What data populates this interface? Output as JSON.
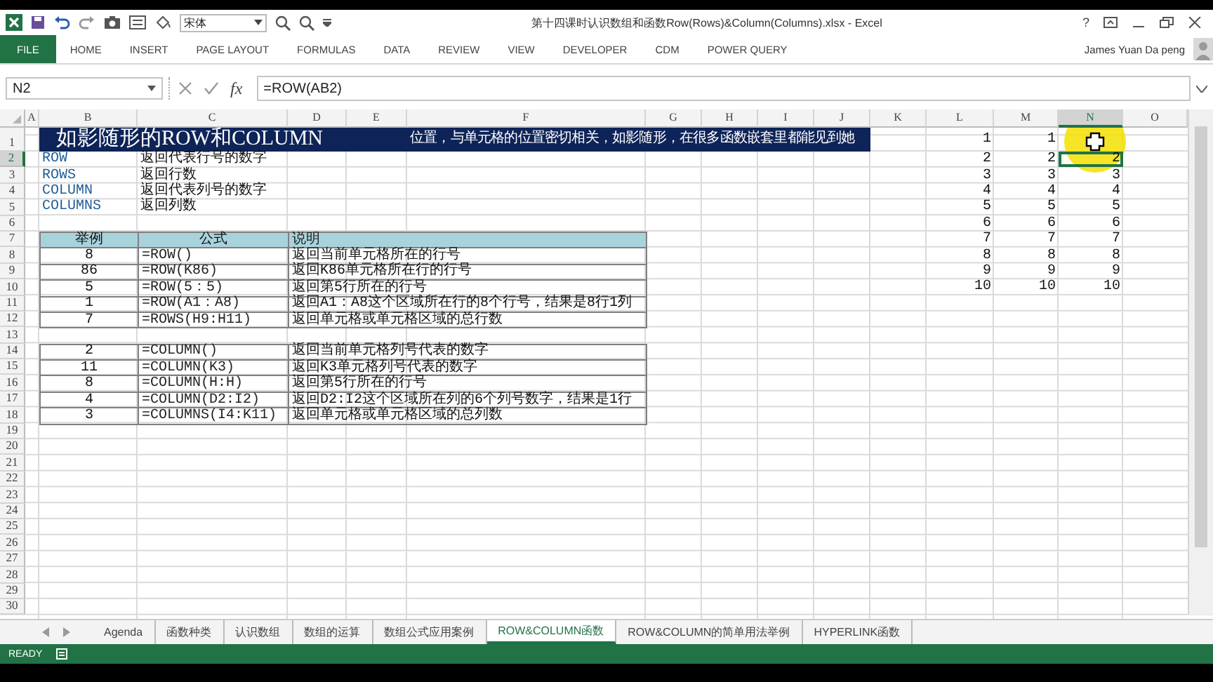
{
  "title_bar": {
    "font_name": "宋体",
    "title": "第十四课时认识数组和函数Row(Rows)&Column(Columns).xlsx - Excel",
    "help": "?"
  },
  "ribbon_tabs": [
    {
      "label": "FILE",
      "kind": "file",
      "selected": false
    },
    {
      "label": "HOME",
      "kind": "tab",
      "selected": false
    },
    {
      "label": "INSERT",
      "kind": "tab",
      "selected": false
    },
    {
      "label": "PAGE LAYOUT",
      "kind": "tab",
      "selected": false
    },
    {
      "label": "FORMULAS",
      "kind": "tab",
      "selected": false
    },
    {
      "label": "DATA",
      "kind": "tab",
      "selected": false
    },
    {
      "label": "REVIEW",
      "kind": "tab",
      "selected": false
    },
    {
      "label": "VIEW",
      "kind": "tab",
      "selected": false
    },
    {
      "label": "DEVELOPER",
      "kind": "tab",
      "selected": false
    },
    {
      "label": "CDM",
      "kind": "tab",
      "selected": false
    },
    {
      "label": "POWER QUERY",
      "kind": "tab",
      "selected": false
    }
  ],
  "user": "James Yuan Da peng",
  "formula_bar": {
    "name_box": "N2",
    "insert_function": "fx",
    "formula": "=ROW(AB2)"
  },
  "columns": [
    {
      "label": "A",
      "selected": false
    },
    {
      "label": "B",
      "selected": false
    },
    {
      "label": "C",
      "selected": false
    },
    {
      "label": "D",
      "selected": false
    },
    {
      "label": "E",
      "selected": false
    },
    {
      "label": "F",
      "selected": false
    },
    {
      "label": "G",
      "selected": false
    },
    {
      "label": "H",
      "selected": false
    },
    {
      "label": "I",
      "selected": false
    },
    {
      "label": "J",
      "selected": false
    },
    {
      "label": "K",
      "selected": false
    },
    {
      "label": "L",
      "selected": false
    },
    {
      "label": "M",
      "selected": false
    },
    {
      "label": "N",
      "selected": true
    },
    {
      "label": "O",
      "selected": false
    }
  ],
  "rows": [
    {
      "number": "1",
      "kind": "title",
      "selected": false,
      "cells": {
        "B": {
          "text": "如影随形的ROW和COLUMN",
          "kind": "heading",
          "selected": false
        },
        "F": {
          "text": "位置，与单元格的位置密切相关，如影随形，在很多函数嵌套里都能见到她",
          "kind": "note",
          "selected": false
        },
        "L": {
          "text": "1",
          "kind": "number",
          "selected": false
        },
        "M": {
          "text": "1",
          "kind": "number",
          "selected": false
        }
      }
    },
    {
      "number": "2",
      "kind": "plain",
      "selected": true,
      "cells": {
        "B": {
          "text": "ROW",
          "kind": "function",
          "selected": false
        },
        "C": {
          "text": "返回代表行号的数字",
          "kind": "text",
          "selected": false
        },
        "L": {
          "text": "2",
          "kind": "number",
          "selected": false
        },
        "M": {
          "text": "2",
          "kind": "number",
          "selected": false
        },
        "N": {
          "text": "2",
          "kind": "number",
          "selected": true
        }
      }
    },
    {
      "number": "3",
      "kind": "plain",
      "selected": false,
      "cells": {
        "B": {
          "text": "ROWS",
          "kind": "function",
          "selected": false
        },
        "C": {
          "text": "返回行数",
          "kind": "text",
          "selected": false
        },
        "L": {
          "text": "3",
          "kind": "number",
          "selected": false
        },
        "M": {
          "text": "3",
          "kind": "number",
          "selected": false
        },
        "N": {
          "text": "3",
          "kind": "number",
          "selected": false
        }
      }
    },
    {
      "number": "4",
      "kind": "plain",
      "selected": false,
      "cells": {
        "B": {
          "text": "COLUMN",
          "kind": "function",
          "selected": false
        },
        "C": {
          "text": "返回代表列号的数字",
          "kind": "text",
          "selected": false
        },
        "L": {
          "text": "4",
          "kind": "number",
          "selected": false
        },
        "M": {
          "text": "4",
          "kind": "number",
          "selected": false
        },
        "N": {
          "text": "4",
          "kind": "number",
          "selected": false
        }
      }
    },
    {
      "number": "5",
      "kind": "plain",
      "selected": false,
      "cells": {
        "B": {
          "text": "COLUMNS",
          "kind": "function",
          "selected": false
        },
        "C": {
          "text": "返回列数",
          "kind": "text",
          "selected": false
        },
        "L": {
          "text": "5",
          "kind": "number",
          "selected": false
        },
        "M": {
          "text": "5",
          "kind": "number",
          "selected": false
        },
        "N": {
          "text": "5",
          "kind": "number",
          "selected": false
        }
      }
    },
    {
      "number": "6",
      "kind": "plain",
      "selected": false,
      "cells": {
        "L": {
          "text": "6",
          "kind": "number",
          "selected": false
        },
        "M": {
          "text": "6",
          "kind": "number",
          "selected": false
        },
        "N": {
          "text": "6",
          "kind": "number",
          "selected": false
        }
      }
    },
    {
      "number": "7",
      "kind": "table-head",
      "selected": false,
      "cells": {
        "B": {
          "text": "举例",
          "kind": "header",
          "selected": false
        },
        "C": {
          "text": "公式",
          "kind": "header",
          "selected": false
        },
        "D": {
          "text": "说明",
          "kind": "header-left",
          "selected": false
        },
        "L": {
          "text": "7",
          "kind": "number",
          "selected": false
        },
        "M": {
          "text": "7",
          "kind": "number",
          "selected": false
        },
        "N": {
          "text": "7",
          "kind": "number",
          "selected": false
        }
      }
    },
    {
      "number": "8",
      "kind": "table-body",
      "selected": false,
      "cells": {
        "B": {
          "text": "8",
          "kind": "example",
          "selected": false
        },
        "C": {
          "text": "=ROW()",
          "kind": "formula",
          "selected": false
        },
        "D": {
          "text": "返回当前单元格所在的行号",
          "kind": "text",
          "selected": false
        },
        "L": {
          "text": "8",
          "kind": "number",
          "selected": false
        },
        "M": {
          "text": "8",
          "kind": "number",
          "selected": false
        },
        "N": {
          "text": "8",
          "kind": "number",
          "selected": false
        }
      }
    },
    {
      "number": "9",
      "kind": "table-body",
      "selected": false,
      "cells": {
        "B": {
          "text": "86",
          "kind": "example",
          "selected": false
        },
        "C": {
          "text": "=ROW(K86)",
          "kind": "formula",
          "selected": false
        },
        "D": {
          "text": "返回K86单元格所在行的行号",
          "kind": "text",
          "selected": false
        },
        "L": {
          "text": "9",
          "kind": "number",
          "selected": false
        },
        "M": {
          "text": "9",
          "kind": "number",
          "selected": false
        },
        "N": {
          "text": "9",
          "kind": "number",
          "selected": false
        }
      }
    },
    {
      "number": "10",
      "kind": "table-body",
      "selected": false,
      "cells": {
        "B": {
          "text": "5",
          "kind": "example",
          "selected": false
        },
        "C": {
          "text": "=ROW(5：5)",
          "kind": "formula",
          "selected": false
        },
        "D": {
          "text": "返回第5行所在的行号",
          "kind": "text",
          "selected": false
        },
        "L": {
          "text": "10",
          "kind": "number",
          "selected": false
        },
        "M": {
          "text": "10",
          "kind": "number",
          "selected": false
        },
        "N": {
          "text": "10",
          "kind": "number",
          "selected": false
        }
      }
    },
    {
      "number": "11",
      "kind": "table-body",
      "selected": false,
      "cells": {
        "B": {
          "text": "1",
          "kind": "example",
          "selected": false
        },
        "C": {
          "text": "=ROW(A1：A8)",
          "kind": "formula",
          "selected": false
        },
        "D": {
          "text": "返回A1：A8这个区域所在行的8个行号，结果是8行1列",
          "kind": "text",
          "selected": false
        }
      }
    },
    {
      "number": "12",
      "kind": "table-body",
      "selected": false,
      "cells": {
        "B": {
          "text": "7",
          "kind": "example",
          "selected": false
        },
        "C": {
          "text": "=ROWS(H9:H11)",
          "kind": "formula",
          "selected": false
        },
        "D": {
          "text": "返回单元格或单元格区域的总行数",
          "kind": "text",
          "selected": false
        }
      }
    },
    {
      "number": "13",
      "kind": "plain",
      "selected": false
    },
    {
      "number": "14",
      "kind": "table-body",
      "selected": false,
      "cells": {
        "B": {
          "text": "2",
          "kind": "example",
          "selected": false
        },
        "C": {
          "text": "=COLUMN()",
          "kind": "formula",
          "selected": false
        },
        "D": {
          "text": "返回当前单元格列号代表的数字",
          "kind": "text",
          "selected": false
        }
      }
    },
    {
      "number": "15",
      "kind": "table-body",
      "selected": false,
      "cells": {
        "B": {
          "text": "11",
          "kind": "example",
          "selected": false
        },
        "C": {
          "text": "=COLUMN(K3)",
          "kind": "formula",
          "selected": false
        },
        "D": {
          "text": "返回K3单元格列号代表的数字",
          "kind": "text",
          "selected": false
        }
      }
    },
    {
      "number": "16",
      "kind": "table-body",
      "selected": false,
      "cells": {
        "B": {
          "text": "8",
          "kind": "example",
          "selected": false
        },
        "C": {
          "text": "=COLUMN(H:H)",
          "kind": "formula",
          "selected": false
        },
        "D": {
          "text": "返回第5行所在的行号",
          "kind": "text",
          "selected": false
        }
      }
    },
    {
      "number": "17",
      "kind": "table-body",
      "selected": false,
      "cells": {
        "B": {
          "text": "4",
          "kind": "example",
          "selected": false
        },
        "C": {
          "text": "=COLUMN(D2:I2)",
          "kind": "formula",
          "selected": false
        },
        "D": {
          "text": "返回D2:I2这个区域所在列的6个列号数字，结果是1行",
          "kind": "text",
          "selected": false
        }
      }
    },
    {
      "number": "18",
      "kind": "table-body",
      "selected": false,
      "cells": {
        "B": {
          "text": "3",
          "kind": "example",
          "selected": false
        },
        "C": {
          "text": "=COLUMNS(I4:K11)",
          "kind": "formula",
          "selected": false
        },
        "D": {
          "text": "返回单元格或单元格区域的总列数",
          "kind": "text",
          "selected": false
        }
      }
    },
    {
      "number": "19",
      "kind": "plain",
      "selected": false
    },
    {
      "number": "20",
      "kind": "plain",
      "selected": false
    },
    {
      "number": "21",
      "kind": "plain",
      "selected": false
    },
    {
      "number": "22",
      "kind": "plain",
      "selected": false
    },
    {
      "number": "23",
      "kind": "plain",
      "selected": false
    },
    {
      "number": "24",
      "kind": "plain",
      "selected": false
    },
    {
      "number": "25",
      "kind": "plain",
      "selected": false
    },
    {
      "number": "26",
      "kind": "plain",
      "selected": false
    },
    {
      "number": "27",
      "kind": "plain",
      "selected": false
    },
    {
      "number": "28",
      "kind": "plain",
      "selected": false
    },
    {
      "number": "29",
      "kind": "plain",
      "selected": false
    },
    {
      "number": "30",
      "kind": "plain",
      "selected": false
    }
  ],
  "sheet_tabs": [
    {
      "label": "Agenda",
      "selected": false
    },
    {
      "label": "函数种类",
      "selected": false
    },
    {
      "label": "认识数组",
      "selected": false
    },
    {
      "label": "数组的运算",
      "selected": false
    },
    {
      "label": "数组公式应用案例",
      "selected": false
    },
    {
      "label": "ROW&COLUMN函数",
      "selected": true
    },
    {
      "label": "ROW&COLUMN的简单用法举例",
      "selected": false
    },
    {
      "label": "HYPERLINK函数",
      "selected": false
    }
  ],
  "status_bar": {
    "text": "READY"
  }
}
